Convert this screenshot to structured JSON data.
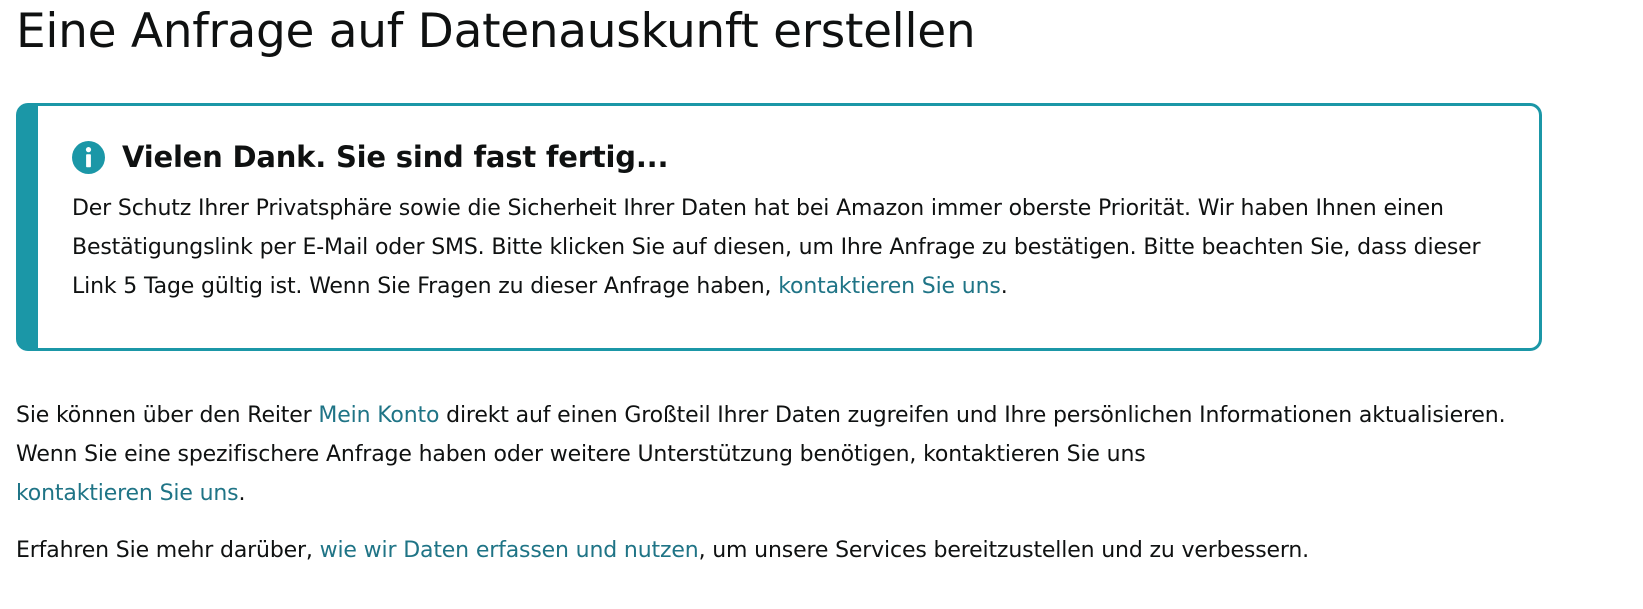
{
  "page": {
    "title": "Eine Anfrage auf Datenauskunft erstellen"
  },
  "alert": {
    "icon": "info-icon",
    "title": "Vielen Dank. Sie sind fast fertig...",
    "body_text": "Der Schutz Ihrer Privatsphäre sowie die Sicherheit Ihrer Daten hat bei Amazon immer oberste Priorität. Wir haben Ihnen einen Bestätigungslink per E-Mail oder SMS. Bitte klicken Sie auf diesen, um Ihre Anfrage zu bestätigen. Bitte beachten Sie, dass dieser Link 5 Tage gültig ist. Wenn Sie Fragen zu dieser Anfrage haben, ",
    "contact_link": "kontaktieren Sie uns",
    "body_end": "."
  },
  "account_paragraph": {
    "prefix": "Sie können über den Reiter ",
    "account_link": "Mein Konto",
    "middle": " direkt auf einen Großteil Ihrer Daten zugreifen und Ihre persönlichen Informationen aktualisieren. Wenn Sie eine spezifischere Anfrage haben oder weitere Unterstützung benötigen, kontaktieren Sie uns ",
    "contact_link": "kontaktieren Sie uns",
    "suffix": "."
  },
  "data_paragraph": {
    "prefix": "Erfahren Sie mehr darüber, ",
    "data_link": "wie wir Daten erfassen und nutzen",
    "suffix": ", um unsere Services bereitzustellen und zu verbessern."
  },
  "colors": {
    "accent": "#1b97a7",
    "link": "#1f7486",
    "text": "#0f1111"
  }
}
